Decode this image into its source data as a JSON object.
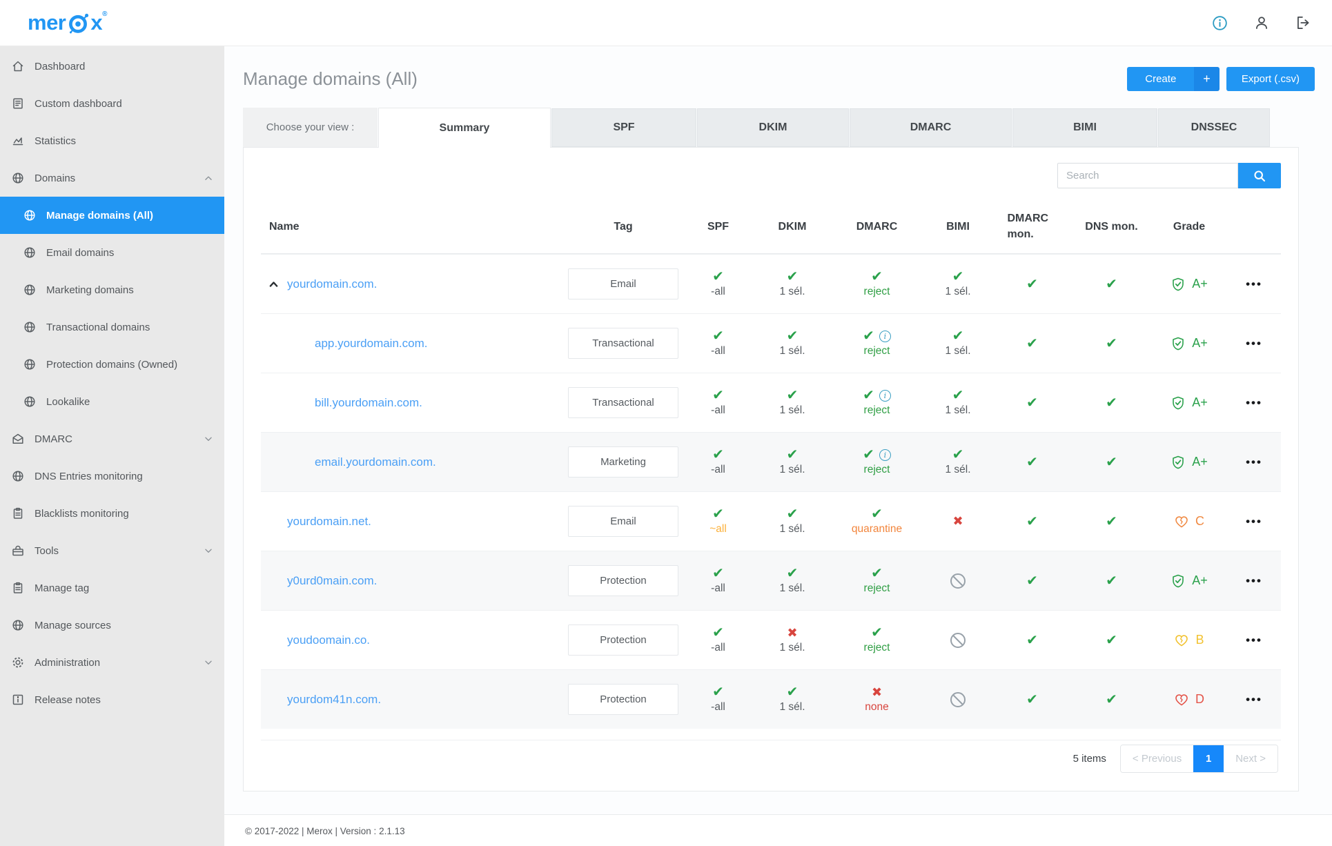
{
  "brand": {
    "word_prefix": "mer",
    "word_suffix": "x",
    "registered": "®",
    "logo_color": "#2196f3"
  },
  "topbar": {
    "icons": [
      "info-circle",
      "user",
      "logout"
    ]
  },
  "sidebar": {
    "items": [
      {
        "label": "Dashboard",
        "icon": "home"
      },
      {
        "label": "Custom dashboard",
        "icon": "document"
      },
      {
        "label": "Statistics",
        "icon": "chart"
      },
      {
        "label": "Domains",
        "icon": "globe",
        "chevron": "up"
      },
      {
        "label": "Manage domains (All)",
        "icon": "globe",
        "child": true,
        "active": true
      },
      {
        "label": "Email domains",
        "icon": "globe",
        "child": true
      },
      {
        "label": "Marketing domains",
        "icon": "globe",
        "child": true
      },
      {
        "label": "Transactional domains",
        "icon": "globe",
        "child": true
      },
      {
        "label": "Protection domains (Owned)",
        "icon": "globe",
        "child": true
      },
      {
        "label": "Lookalike",
        "icon": "globe",
        "child": true
      },
      {
        "label": "DMARC",
        "icon": "mail-open",
        "chevron": "down"
      },
      {
        "label": "DNS Entries monitoring",
        "icon": "globe"
      },
      {
        "label": "Blacklists monitoring",
        "icon": "clipboard"
      },
      {
        "label": "Tools",
        "icon": "toolbox",
        "chevron": "down"
      },
      {
        "label": "Manage tag",
        "icon": "clipboard"
      },
      {
        "label": "Manage sources",
        "icon": "globe"
      },
      {
        "label": "Administration",
        "icon": "gear",
        "chevron": "down"
      },
      {
        "label": "Release notes",
        "icon": "info-square"
      }
    ]
  },
  "page": {
    "title": "Manage domains (All)",
    "create_label": "Create",
    "create_plus": "+",
    "export_label": "Export (.csv)"
  },
  "tabs": {
    "label": "Choose your view :",
    "active": "Summary",
    "items": [
      "Summary",
      "SPF",
      "DKIM",
      "DMARC",
      "BIMI",
      "DNSSEC"
    ]
  },
  "search": {
    "placeholder": "Search"
  },
  "table": {
    "columns": [
      "Name",
      "Tag",
      "SPF",
      "DKIM",
      "DMARC",
      "BIMI",
      "DMARC mon.",
      "DNS mon.",
      "Grade"
    ],
    "rows": [
      {
        "name": "yourdomain.com.",
        "tag": "Email",
        "caret": "up",
        "spf": {
          "icon": "check",
          "label": "-all"
        },
        "dkim": {
          "icon": "check",
          "label": "1 sél."
        },
        "dmarc": {
          "icon": "check",
          "info": false,
          "label": "reject",
          "tone": "green"
        },
        "bimi": {
          "icon": "check",
          "label": "1 sél."
        },
        "dmarc_mon": {
          "icon": "check"
        },
        "dns_mon": {
          "icon": "check"
        },
        "grade": {
          "icon": "shield-check",
          "label": "A+",
          "tone": "green"
        }
      },
      {
        "name": "app.yourdomain.com.",
        "tag": "Transactional",
        "child": true,
        "spf": {
          "icon": "check",
          "label": "-all"
        },
        "dkim": {
          "icon": "check",
          "label": "1 sél."
        },
        "dmarc": {
          "icon": "check",
          "info": true,
          "label": "reject",
          "tone": "green"
        },
        "bimi": {
          "icon": "check",
          "label": "1 sél."
        },
        "dmarc_mon": {
          "icon": "check"
        },
        "dns_mon": {
          "icon": "check"
        },
        "grade": {
          "icon": "shield-check",
          "label": "A+",
          "tone": "green"
        }
      },
      {
        "name": "bill.yourdomain.com.",
        "tag": "Transactional",
        "child": true,
        "spf": {
          "icon": "check",
          "label": "-all"
        },
        "dkim": {
          "icon": "check",
          "label": "1 sél."
        },
        "dmarc": {
          "icon": "check",
          "info": true,
          "label": "reject",
          "tone": "green"
        },
        "bimi": {
          "icon": "check",
          "label": "1 sél."
        },
        "dmarc_mon": {
          "icon": "check"
        },
        "dns_mon": {
          "icon": "check"
        },
        "grade": {
          "icon": "shield-check",
          "label": "A+",
          "tone": "green"
        }
      },
      {
        "name": "email.yourdomain.com.",
        "tag": "Marketing",
        "child": true,
        "shaded": true,
        "spf": {
          "icon": "check",
          "label": "-all"
        },
        "dkim": {
          "icon": "check",
          "label": "1 sél."
        },
        "dmarc": {
          "icon": "check",
          "info": true,
          "label": "reject",
          "tone": "green"
        },
        "bimi": {
          "icon": "check",
          "label": "1 sél."
        },
        "dmarc_mon": {
          "icon": "check"
        },
        "dns_mon": {
          "icon": "check"
        },
        "grade": {
          "icon": "shield-check",
          "label": "A+",
          "tone": "green"
        }
      },
      {
        "name": "yourdomain.net.",
        "tag": "Email",
        "spf": {
          "icon": "check",
          "label": "~all",
          "tone": "amber"
        },
        "dkim": {
          "icon": "check",
          "label": "1 sél."
        },
        "dmarc": {
          "icon": "check",
          "info": false,
          "label": "quarantine",
          "tone": "orange"
        },
        "bimi": {
          "icon": "x"
        },
        "dmarc_mon": {
          "icon": "check"
        },
        "dns_mon": {
          "icon": "check"
        },
        "grade": {
          "icon": "heart-crack",
          "label": "C",
          "tone": "c-orange"
        }
      },
      {
        "name": "y0urd0main.com.",
        "tag": "Protection",
        "shaded": true,
        "spf": {
          "icon": "check",
          "label": "-all"
        },
        "dkim": {
          "icon": "check",
          "label": "1 sél."
        },
        "dmarc": {
          "icon": "check",
          "info": false,
          "label": "reject",
          "tone": "green"
        },
        "bimi": {
          "icon": "ban"
        },
        "dmarc_mon": {
          "icon": "check"
        },
        "dns_mon": {
          "icon": "check"
        },
        "grade": {
          "icon": "shield-check",
          "label": "A+",
          "tone": "green"
        }
      },
      {
        "name": "youdoomain.co.",
        "tag": "Protection",
        "spf": {
          "icon": "check",
          "label": "-all"
        },
        "dkim": {
          "icon": "x",
          "label": "1 sél."
        },
        "dmarc": {
          "icon": "check",
          "info": false,
          "label": "reject",
          "tone": "green"
        },
        "bimi": {
          "icon": "ban"
        },
        "dmarc_mon": {
          "icon": "check"
        },
        "dns_mon": {
          "icon": "check"
        },
        "grade": {
          "icon": "heart-crack",
          "label": "B",
          "tone": "b-yellow"
        }
      },
      {
        "name": "yourdom41n.com.",
        "tag": "Protection",
        "shaded": true,
        "spf": {
          "icon": "check",
          "label": "-all"
        },
        "dkim": {
          "icon": "check",
          "label": "1 sél."
        },
        "dmarc": {
          "icon": "x",
          "label": "none",
          "tone": "red"
        },
        "bimi": {
          "icon": "ban"
        },
        "dmarc_mon": {
          "icon": "check"
        },
        "dns_mon": {
          "icon": "check"
        },
        "grade": {
          "icon": "heart-crack",
          "label": "D",
          "tone": "d-red"
        }
      }
    ]
  },
  "pagination": {
    "items_text": "5 items",
    "previous_chevron": "<",
    "previous": "Previous",
    "page": "1",
    "next": "Next",
    "next_chevron": ">"
  },
  "footer": {
    "copyright": "© 2017-2022 | Merox | Version : 2.1.13"
  },
  "colors": {
    "primary": "#2196f3",
    "green": "#2aa14b",
    "red": "#d8453e",
    "orange": "#f2853c",
    "amber": "#fbb03a",
    "yellow": "#f2c230",
    "info_teal": "#3a9ec2"
  }
}
